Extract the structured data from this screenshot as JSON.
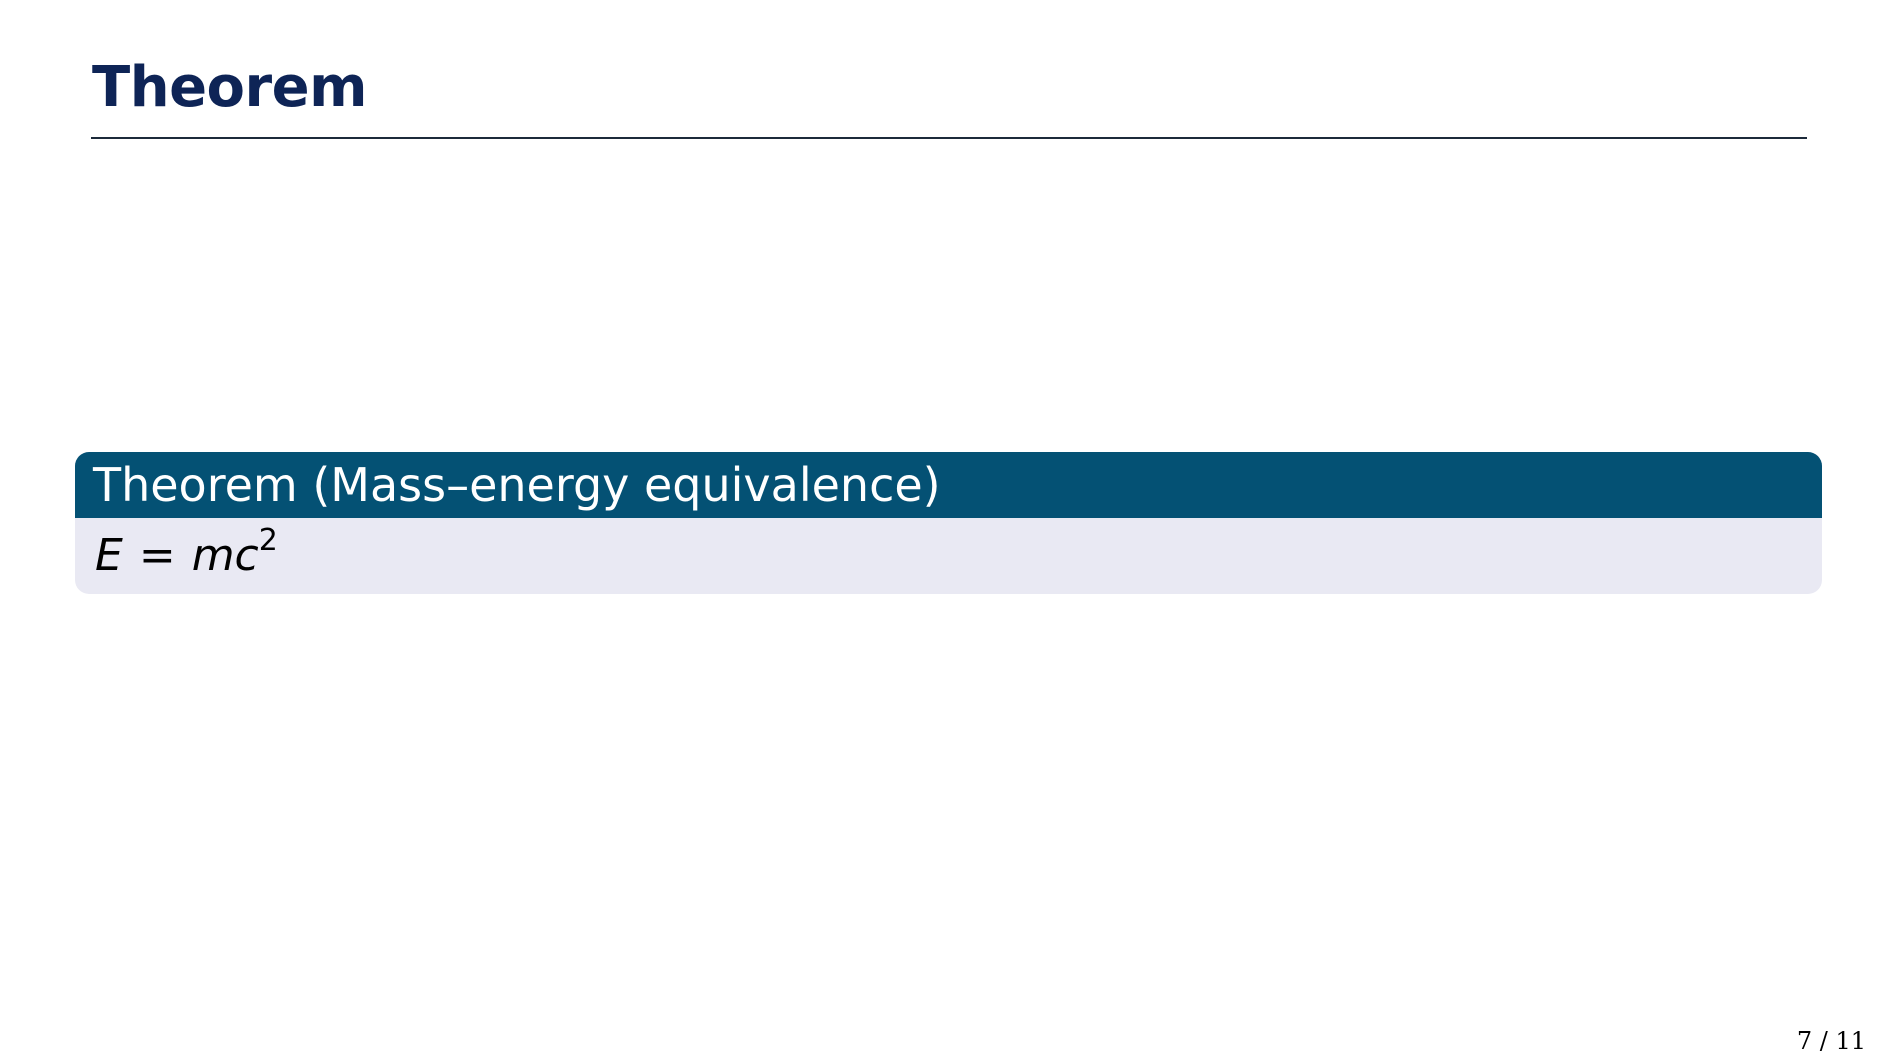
{
  "slide": {
    "title": "Theorem"
  },
  "theorem": {
    "header": "Theorem (Mass–energy equivalence)",
    "equation": {
      "lhs": "E",
      "operator": "=",
      "rhs_base": "mc",
      "exponent": "2"
    }
  },
  "footer": {
    "page_number": "7 / 11"
  },
  "colors": {
    "title": "#0e2456",
    "block_header_bg": "#045174",
    "block_body_bg": "#e9e9f3",
    "rule": "#1c2a3a"
  }
}
